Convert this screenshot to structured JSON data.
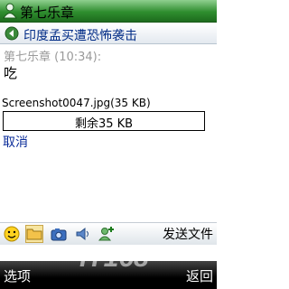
{
  "titlebar": {
    "title": "第七乐章",
    "icon": "contact-person-icon"
  },
  "conversation": {
    "title": "印度孟买遭恐怖袭击",
    "icon": "back-nav-icon"
  },
  "message": {
    "sender_line": "第七乐章 (10:34):",
    "text": "吃"
  },
  "file_transfer": {
    "file_line": "Screenshot0047.jpg(35 KB)",
    "remaining_label": "剩余35 KB",
    "progress_fraction": 0,
    "cancel_label": "取消"
  },
  "toolbar": {
    "buttons": [
      "smiley-icon",
      "folder-icon",
      "camera-icon",
      "speaker-icon",
      "add-contact-icon"
    ],
    "send_file_label": "发送文件"
  },
  "softkeys": {
    "left": "选项",
    "right": "返回"
  },
  "watermark": {
    "text": "IT168"
  },
  "colors": {
    "titlebar": "#2f8e2f",
    "conversation_title": "#002b86",
    "link": "#0b2d9a"
  }
}
